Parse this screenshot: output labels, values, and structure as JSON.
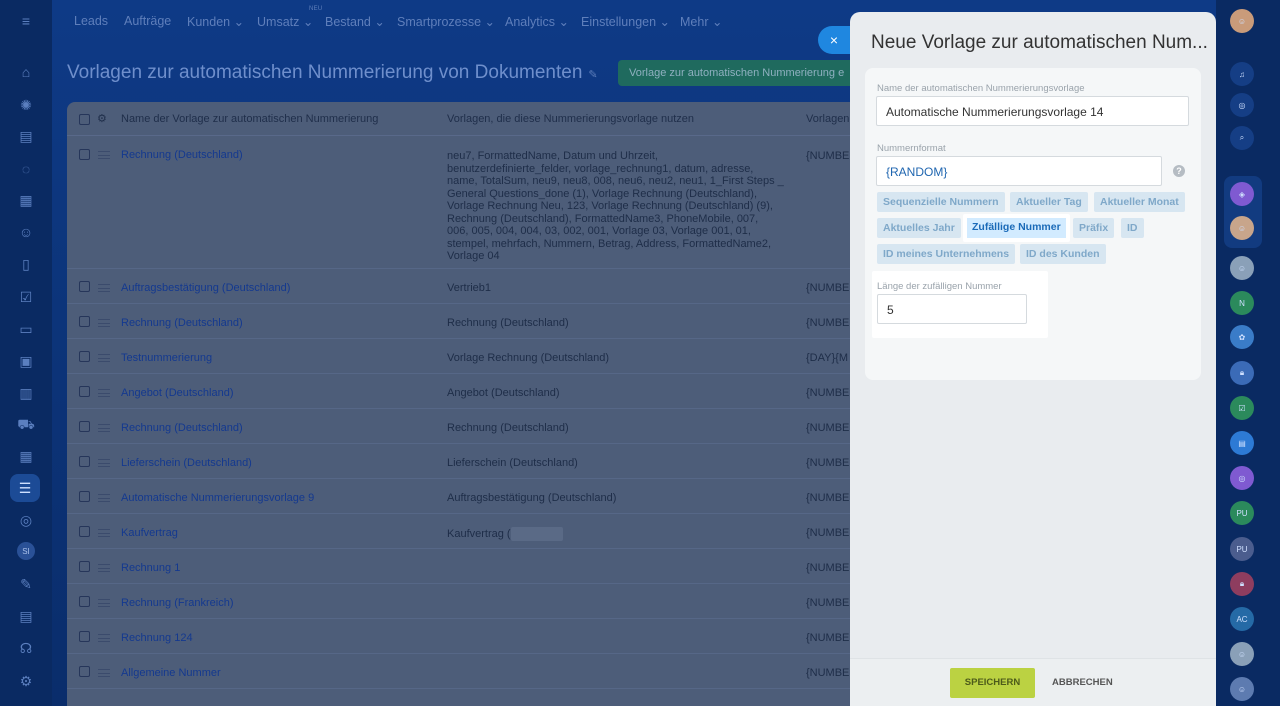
{
  "topnav": {
    "menu_icon": "hamburger-icon",
    "neu_badge": "NEU",
    "items": [
      "Leads",
      "Aufträge",
      "Kunden ⌄",
      "Umsatz ⌄",
      "Bestand ⌄",
      "Smartprozesse ⌄",
      "Analytics ⌄",
      "Einstellungen ⌄",
      "Mehr ⌄"
    ]
  },
  "left_sidebar": {
    "icons": [
      "home-icon",
      "activity-icon",
      "feed-icon",
      "chat-icon",
      "calendar-icon",
      "contacts-icon",
      "documents-icon",
      "tasks-icon",
      "crm-icon",
      "monitor-icon",
      "analytics-icon",
      "shop-icon",
      "planner-icon",
      "automation-icon",
      "goals-icon",
      "user-avatar-icon",
      "signature-icon",
      "invoice-icon",
      "support-icon",
      "settings-icon"
    ],
    "si_label": "SI"
  },
  "page": {
    "title": "Vorlagen zur automatischen Nummerierung von Dokumenten",
    "add_button": "Vorlage zur automatischen Nummerierung e"
  },
  "table": {
    "headers": {
      "name": "Name der Vorlage zur automatischen Nummerierung",
      "uses": "Vorlagen, die diese Nummerierungsvorlage nutzen",
      "format": "Vorlagen"
    },
    "rows": [
      {
        "name": "Rechnung (Deutschland)",
        "uses_lines": [
          "neu7, FormattedName, Datum und Uhrzeit,",
          "benutzerdefinierte_felder, vorlage_rechnung1, datum, adresse,",
          "name, TotalSum, neu9, neu8, 008, neu6, neu2, neu1, 1_First Steps _",
          "General Questions_done (1), Vorlage Rechnung (Deutschland),",
          "Vorlage Rechnung Neu, 123, Vorlage Rechnung (Deutschland) (9),",
          "Rechnung (Deutschland), FormattedName3, PhoneMobile, 007,",
          "006, 005, 004, 004, 03, 002, 001, Vorlage 03, Vorlage 001, 01,",
          "stempel, mehrfach, Nummern, Betrag, Address, FormattedName2,",
          "Vorlage 04"
        ],
        "format": "{NUMBE"
      },
      {
        "name": "Auftragsbestätigung (Deutschland)",
        "uses": "Vertrieb1",
        "format": "{NUMBE"
      },
      {
        "name": "Rechnung (Deutschland)",
        "uses": "Rechnung (Deutschland)",
        "format": "{NUMBE"
      },
      {
        "name": "Testnummerierung",
        "uses": "Vorlage Rechnung (Deutschland)",
        "format": "{DAY}{M"
      },
      {
        "name": "Angebot (Deutschland)",
        "uses": "Angebot (Deutschland)",
        "format": "{NUMBE"
      },
      {
        "name": "Rechnung (Deutschland)",
        "uses": "Rechnung (Deutschland)",
        "format": "{NUMBE"
      },
      {
        "name": "Lieferschein (Deutschland)",
        "uses": "Lieferschein (Deutschland)",
        "format": "{NUMBE"
      },
      {
        "name": "Automatische Nummerierungsvorlage 9",
        "uses": "Auftragsbestätigung (Deutschland)",
        "format": "{NUMBE"
      },
      {
        "name": "Kaufvertrag",
        "uses": "Kaufvertrag (",
        "format": "{NUMBE"
      },
      {
        "name": "Rechnung 1",
        "uses": "",
        "format": "{NUMBE"
      },
      {
        "name": "Rechnung (Frankreich)",
        "uses": "",
        "format": "{NUMBE"
      },
      {
        "name": "Rechnung 124",
        "uses": "",
        "format": "{NUMBE"
      },
      {
        "name": "Allgemeine Nummer",
        "uses": "",
        "format": "{NUMBE"
      }
    ]
  },
  "slider": {
    "title": "Neue Vorlage zur automatischen Num...",
    "close_icon": "×",
    "name_label": "Name der automatischen Nummerierungsvorlage",
    "name_value": "Automatische Nummerierungsvorlage  14",
    "format_label": "Nummernformat",
    "format_value": "{RANDOM}",
    "help_icon": "?",
    "tags": [
      "Sequenzielle Nummern",
      "Aktueller Tag",
      "Aktueller Monat",
      "Aktuelles Jahr",
      "Zufällige Nummer",
      "Präfix",
      "ID",
      "ID meines Unternehmens",
      "ID des Kunden"
    ],
    "selected_tag": "Zufällige Nummer",
    "length_label": "Länge der zufälligen Nummer",
    "length_value": "5",
    "save": "SPEICHERN",
    "cancel": "ABBRECHEN"
  },
  "right_sidebar": {
    "items": [
      "notifications-icon",
      "copilot-icon",
      "search-icon",
      "bot-avatar",
      "user-avatar",
      "group-avatar",
      "N",
      "chat-avatar",
      "lock-avatar",
      "task-avatar",
      "message-avatar",
      "spiral-avatar",
      "PU",
      "PU",
      "lock-avatar-2",
      "AC",
      "group-avatar-2",
      "group-avatar-3"
    ]
  },
  "colors": {
    "accent": "#1f87e0",
    "save": "#bbd242",
    "selected_tag": "#1a6ab8"
  }
}
